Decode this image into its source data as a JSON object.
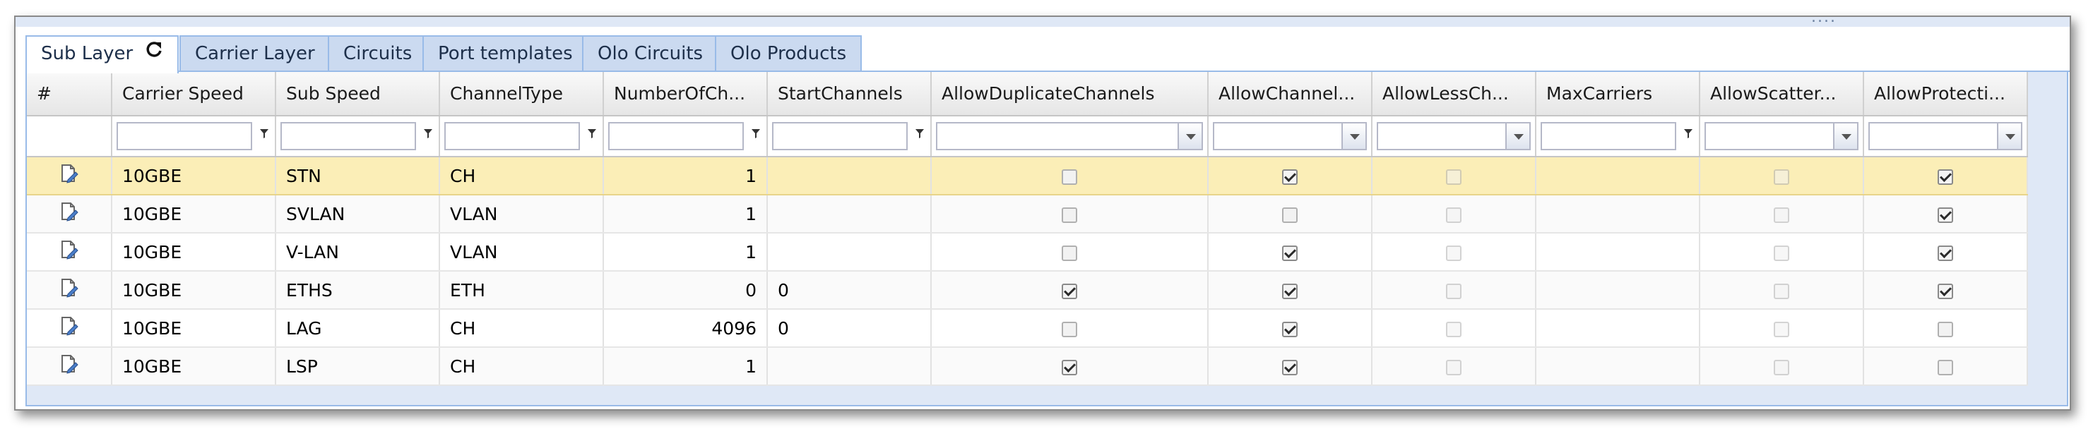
{
  "tabs": [
    {
      "label": "Sub Layer",
      "active": true,
      "icon": "refresh-icon"
    },
    {
      "label": "Carrier Layer",
      "active": false
    },
    {
      "label": "Circuits",
      "active": false
    },
    {
      "label": "Port templates",
      "active": false
    },
    {
      "label": "Olo Circuits",
      "active": false
    },
    {
      "label": "Olo Products",
      "active": false
    }
  ],
  "grid": {
    "columns": [
      {
        "key": "index",
        "label": "#",
        "filter": "none"
      },
      {
        "key": "carrier_speed",
        "label": "Carrier Speed",
        "filter": "text"
      },
      {
        "key": "sub_speed",
        "label": "Sub Speed",
        "filter": "text"
      },
      {
        "key": "channel_type",
        "label": "ChannelType",
        "filter": "text"
      },
      {
        "key": "number_of_channels",
        "label": "NumberOfCh...",
        "filter": "text"
      },
      {
        "key": "start_channels",
        "label": "StartChannels",
        "filter": "text"
      },
      {
        "key": "allow_duplicate_channels",
        "label": "AllowDuplicateChannels",
        "filter": "combo"
      },
      {
        "key": "allow_channel",
        "label": "AllowChannel...",
        "filter": "combo"
      },
      {
        "key": "allow_less_ch",
        "label": "AllowLessCh...",
        "filter": "combo"
      },
      {
        "key": "max_carriers",
        "label": "MaxCarriers",
        "filter": "text"
      },
      {
        "key": "allow_scatter",
        "label": "AllowScatter...",
        "filter": "combo"
      },
      {
        "key": "allow_protection",
        "label": "AllowProtecti...",
        "filter": "combo"
      }
    ],
    "rows": [
      {
        "carrier_speed": "10GBE",
        "sub_speed": "STN",
        "channel_type": "CH",
        "number_of_channels": "1",
        "start_channels": "",
        "allow_duplicate_channels": false,
        "allow_channel": true,
        "allow_less_ch": false,
        "max_carriers": "",
        "allow_scatter": false,
        "allow_protection": true,
        "selected": true
      },
      {
        "carrier_speed": "10GBE",
        "sub_speed": "SVLAN",
        "channel_type": "VLAN",
        "number_of_channels": "1",
        "start_channels": "",
        "allow_duplicate_channels": false,
        "allow_channel": false,
        "allow_less_ch": false,
        "max_carriers": "",
        "allow_scatter": false,
        "allow_protection": true
      },
      {
        "carrier_speed": "10GBE",
        "sub_speed": "V-LAN",
        "channel_type": "VLAN",
        "number_of_channels": "1",
        "start_channels": "",
        "allow_duplicate_channels": false,
        "allow_channel": true,
        "allow_less_ch": false,
        "max_carriers": "",
        "allow_scatter": false,
        "allow_protection": true
      },
      {
        "carrier_speed": "10GBE",
        "sub_speed": "ETHS",
        "channel_type": "ETH",
        "number_of_channels": "0",
        "start_channels": "0",
        "allow_duplicate_channels": true,
        "allow_channel": true,
        "allow_less_ch": false,
        "max_carriers": "",
        "allow_scatter": false,
        "allow_protection": true
      },
      {
        "carrier_speed": "10GBE",
        "sub_speed": "LAG",
        "channel_type": "CH",
        "number_of_channels": "4096",
        "start_channels": "0",
        "allow_duplicate_channels": false,
        "allow_channel": true,
        "allow_less_ch": false,
        "max_carriers": "",
        "allow_scatter": false,
        "allow_protection": false
      },
      {
        "carrier_speed": "10GBE",
        "sub_speed": "LSP",
        "channel_type": "CH",
        "number_of_channels": "1",
        "start_channels": "",
        "allow_duplicate_channels": true,
        "allow_channel": true,
        "allow_less_ch": false,
        "max_carriers": "",
        "allow_scatter": false,
        "allow_protection": false
      }
    ]
  },
  "icons": {
    "row_edit": "edit-record-icon",
    "filter": "filter-funnel-icon",
    "dropdown": "chevron-down-icon",
    "grip": "drag-grip-icon"
  },
  "colors": {
    "tab_background": "#cbdaf0",
    "border_blue": "#99bbe8",
    "selected_row": "#fbeeb7",
    "grid_background": "#dfe8f6"
  }
}
